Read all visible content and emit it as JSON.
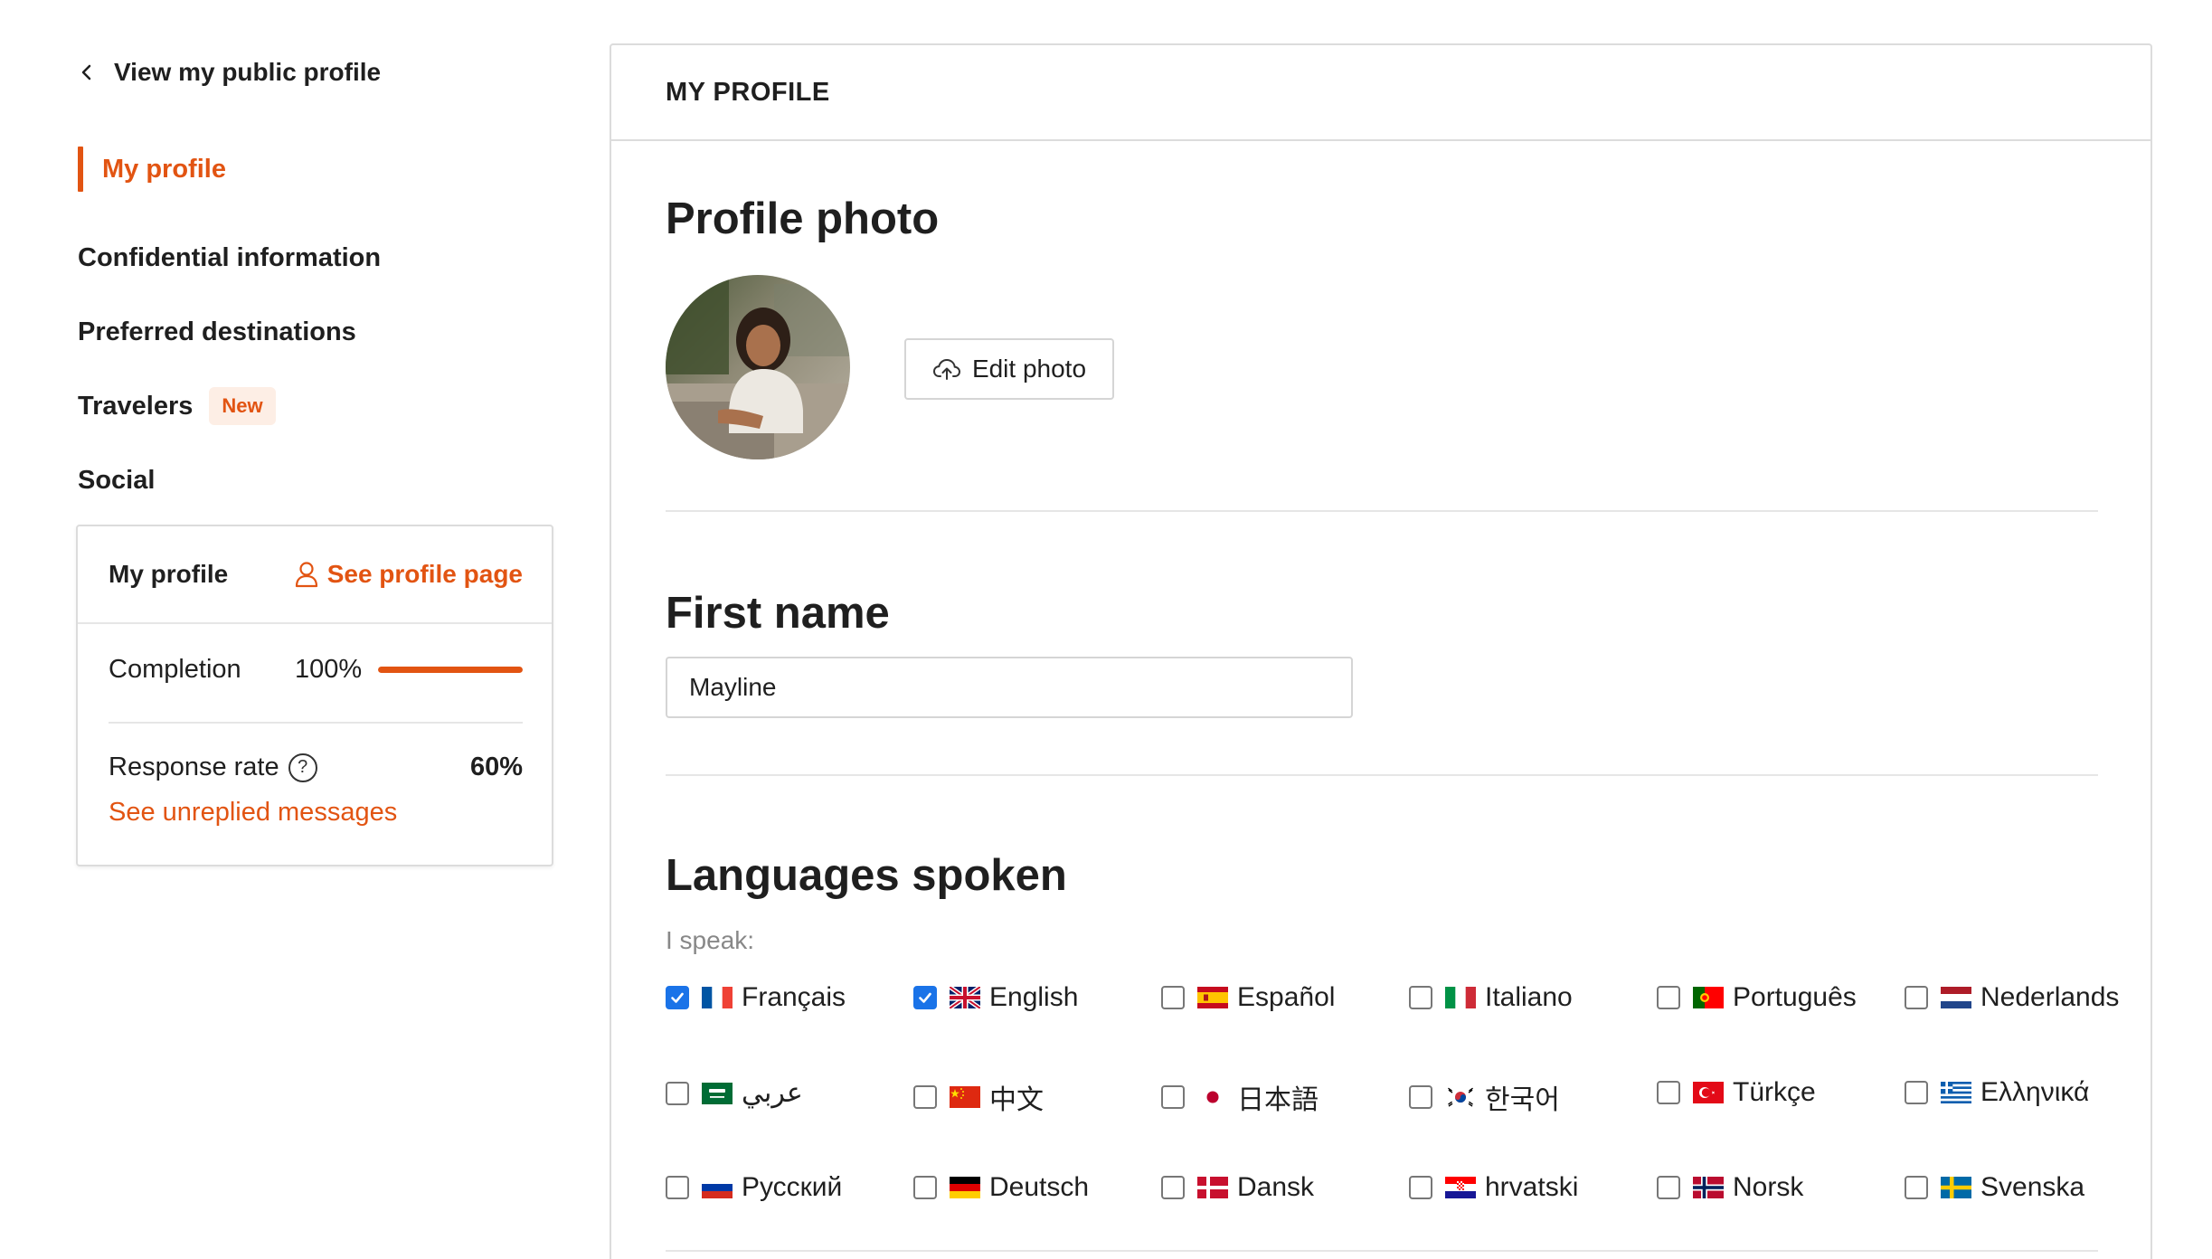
{
  "sidebar": {
    "back_link": "View my public profile",
    "items": [
      {
        "label": "My profile"
      },
      {
        "label": "Confidential information"
      },
      {
        "label": "Preferred destinations"
      },
      {
        "label": "Travelers",
        "badge": "New"
      },
      {
        "label": "Social"
      }
    ],
    "card": {
      "title": "My profile",
      "see_profile": "See profile page",
      "completion_label": "Completion",
      "completion_value": "100%",
      "completion_fraction": 1.0,
      "response_label": "Response rate",
      "response_help": "?",
      "response_value": "60%",
      "unreplied_link": "See unreplied messages"
    }
  },
  "main": {
    "header": "MY PROFILE",
    "photo_title": "Profile photo",
    "edit_photo": "Edit photo",
    "first_name_title": "First name",
    "first_name_value": "Mayline",
    "languages_title": "Languages spoken",
    "speak_label": "I speak:",
    "languages": [
      {
        "name": "Français",
        "flag": "fr-flag-icon",
        "checked": true
      },
      {
        "name": "English",
        "flag": "gb-flag-icon",
        "checked": true
      },
      {
        "name": "Español",
        "flag": "es-flag-icon",
        "checked": false
      },
      {
        "name": "Italiano",
        "flag": "it-flag-icon",
        "checked": false
      },
      {
        "name": "Português",
        "flag": "pt-flag-icon",
        "checked": false
      },
      {
        "name": "Nederlands",
        "flag": "nl-flag-icon",
        "checked": false
      },
      {
        "name": "عربي",
        "flag": "sa-flag-icon",
        "checked": false
      },
      {
        "name": "中文",
        "flag": "cn-flag-icon",
        "checked": false
      },
      {
        "name": "日本語",
        "flag": "jp-flag-icon",
        "checked": false
      },
      {
        "name": "한국어",
        "flag": "kr-flag-icon",
        "checked": false
      },
      {
        "name": "Türkçe",
        "flag": "tr-flag-icon",
        "checked": false
      },
      {
        "name": "Ελληνικά",
        "flag": "gr-flag-icon",
        "checked": false
      },
      {
        "name": "Русский",
        "flag": "ru-flag-icon",
        "checked": false
      },
      {
        "name": "Deutsch",
        "flag": "de-flag-icon",
        "checked": false
      },
      {
        "name": "Dansk",
        "flag": "dk-flag-icon",
        "checked": false
      },
      {
        "name": "hrvatski",
        "flag": "hr-flag-icon",
        "checked": false
      },
      {
        "name": "Norsk",
        "flag": "no-flag-icon",
        "checked": false
      },
      {
        "name": "Svenska",
        "flag": "se-flag-icon",
        "checked": false
      }
    ]
  },
  "colors": {
    "accent": "#e25412",
    "checkbox_checked": "#1a73e8"
  }
}
